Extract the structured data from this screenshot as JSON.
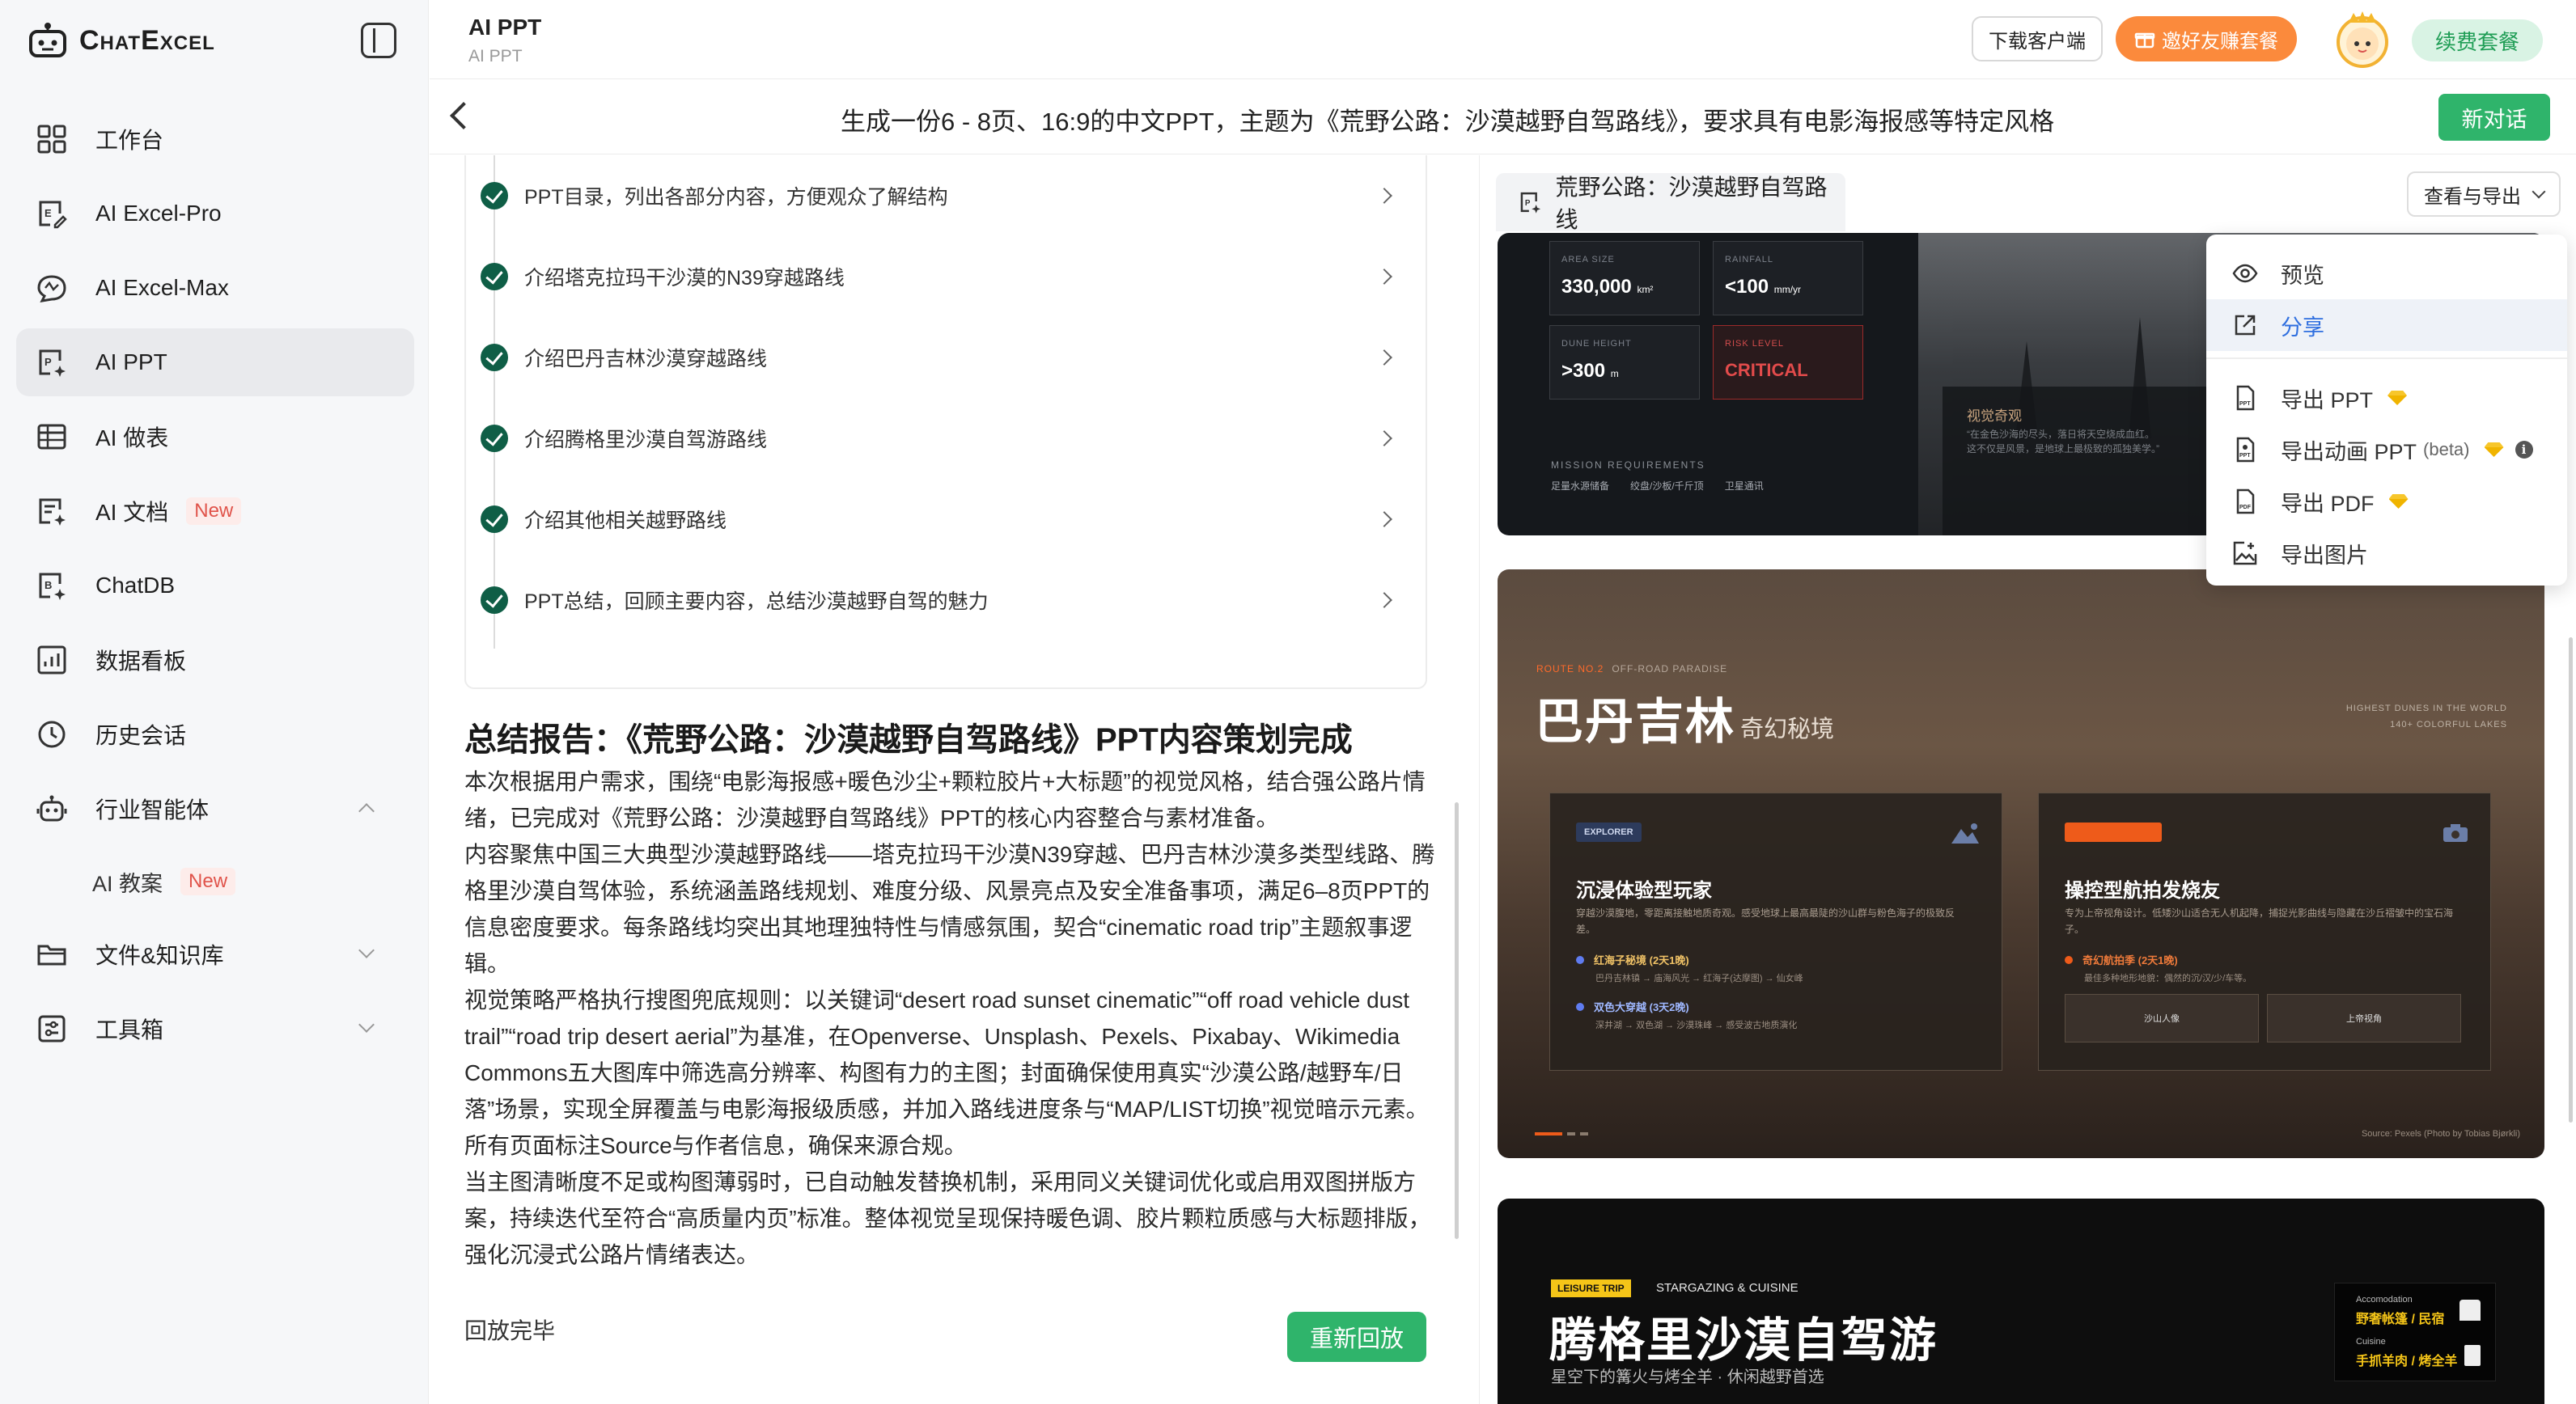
{
  "app": {
    "logo_text": "ChatExcel",
    "title": "AI PPT",
    "subtitle": "AI PPT"
  },
  "sidebar": {
    "items": [
      {
        "label": "工作台",
        "icon": "dashboard-grid-icon"
      },
      {
        "label": "AI Excel-Pro",
        "icon": "excel-edit-icon"
      },
      {
        "label": "AI Excel-Max",
        "icon": "excel-chat-icon"
      },
      {
        "label": "AI PPT",
        "icon": "ppt-icon",
        "active": true
      },
      {
        "label": "AI 做表",
        "icon": "table-icon"
      },
      {
        "label": "AI 文档",
        "icon": "document-icon",
        "badge": "New"
      },
      {
        "label": "ChatDB",
        "icon": "database-icon"
      },
      {
        "label": "数据看板",
        "icon": "chart-board-icon"
      },
      {
        "label": "历史会话",
        "icon": "history-clock-icon"
      },
      {
        "label": "行业智能体",
        "icon": "robot-icon"
      },
      {
        "label": "文件&知识库",
        "icon": "folder-icon"
      },
      {
        "label": "工具箱",
        "icon": "toolbox-icon"
      }
    ],
    "sub_items": [
      {
        "label": "AI 教案",
        "badge": "New"
      }
    ]
  },
  "header": {
    "download_label": "下载客户端",
    "invite_label": "邀好友赚套餐",
    "renew_label": "续费套餐"
  },
  "conversation": {
    "title": "生成一份6 - 8页、16:9的中文PPT，主题为《荒野公路：沙漠越野自驾路线》，要求具有电影海报感等特定风格",
    "new_chat_label": "新对话"
  },
  "steps": [
    "PPT目录，列出各部分内容，方便观众了解结构",
    "介绍塔克拉玛干沙漠的N39穿越路线",
    "介绍巴丹吉林沙漠穿越路线",
    "介绍腾格里沙漠自驾游路线",
    "介绍其他相关越野路线",
    "PPT总结，回顾主要内容，总结沙漠越野自驾的魅力"
  ],
  "report": {
    "title": "总结报告：《荒野公路：沙漠越野自驾路线》PPT内容策划完成",
    "paragraphs": [
      "本次根据用户需求，围绕“电影海报感+暖色沙尘+颗粒胶片+大标题”的视觉风格，结合强公路片情绪，已完成对《荒野公路：沙漠越野自驾路线》PPT的核心内容整合与素材准备。",
      "内容聚焦中国三大典型沙漠越野路线——塔克拉玛干沙漠N39穿越、巴丹吉林沙漠多类型线路、腾格里沙漠自驾体验，系统涵盖路线规划、难度分级、风景亮点及安全准备事项，满足6–8页PPT的信息密度要求。每条路线均突出其地理独特性与情感氛围，契合“cinematic road trip”主题叙事逻辑。",
      "视觉策略严格执行搜图兜底规则：以关键词“desert road sunset cinematic”“off road vehicle dust trail”“road trip desert aerial”为基准，在Openverse、Unsplash、Pexels、Pixabay、Wikimedia Commons五大图库中筛选高分辨率、构图有力的主图；封面确保使用真实“沙漠公路/越野车/日落”场景，实现全屏覆盖与电影海报级质感，并加入路线进度条与“MAP/LIST切换”视觉暗示元素。所有页面标注Source与作者信息，确保来源合规。",
      "当主图清晰度不足或构图薄弱时，已自动触发替换机制，采用同义关键词优化或启用双图拼版方案，持续迭代至符合“高质量内页”标准。整体视觉呈现保持暖色调、胶片颗粒质感与大标题排版，强化沉浸式公路片情绪表达。"
    ],
    "playback_done": "回放完毕",
    "replay_label": "重新回放"
  },
  "preview": {
    "tab_title": "荒野公路：沙漠越野自驾路线",
    "export_label": "查看与导出",
    "slide1": {
      "cards": [
        {
          "label": "AREA SIZE",
          "value": "330,000",
          "unit": "km²"
        },
        {
          "label": "RAINFALL",
          "value": "<100",
          "unit": "mm/yr"
        },
        {
          "label": "DUNE HEIGHT",
          "value": ">300",
          "unit": "m"
        },
        {
          "label": "RISK LEVEL",
          "value": "CRITICAL",
          "unit": ""
        }
      ],
      "mission_label": "MISSION REQUIREMENTS",
      "mission_items": [
        "足量水源储备",
        "绞盘/沙板/千斤顶",
        "卫星通讯"
      ],
      "box_title": "视觉奇观",
      "box_desc": "“在金色沙海的尽头，落日将天空烧成血红。这不仅是风景，是地球上最极致的孤独美学。”"
    },
    "slide2": {
      "tag": "ROUTE NO.2",
      "tag_sub": "OFF-ROAD PARADISE",
      "title": "巴丹吉林",
      "title_sub": "奇幻秘境",
      "right_line1": "HIGHEST DUNES IN THE WORLD",
      "right_line2": "140+ COLORFUL LAKES",
      "card1": {
        "chip": "EXPLORER",
        "head": "沉浸体验型玩家",
        "desc": "穿越沙漠腹地，零距离接触地质奇观。感受地球上最高最陡的沙山群与粉色海子的极致反差。",
        "route1": "红海子秘境 (2天1晚)",
        "route1_d": "巴丹吉林镇 → 庙海风光 → 红海子(达摩图) → 仙女峰",
        "route2": "双色大穿越 (3天2晚)",
        "route2_d": "深井湖 → 双色湖 → 沙漠珠峰 → 感受波古地质演化"
      },
      "card2": {
        "head": "操控型航拍发烧友",
        "desc": "专为上帝视角设计。低矮沙山适合无人机起降，捕捉光影曲线与隐藏在沙丘褶皱中的宝石海子。",
        "route1": "奇幻航拍季 (2天1晚)",
        "route1_d": "最佳多种地形地貌：偶然的沉/汉/少/车等。",
        "btn1": "沙山人像",
        "btn2": "上帝视角"
      },
      "source": "Source: Pexels (Photo by Tobias Bjørkli)"
    },
    "slide3": {
      "tag": "LEISURE TRIP",
      "tag2": "STARGAZING & CUISINE",
      "title": "腾格里沙漠自驾游",
      "subtitle": "星空下的篝火与烤全羊 · 休闲越野首选",
      "box_l1": "Accomodation",
      "box_v1": "野奢帐篷 / 民宿",
      "box_l2": "Cuisine",
      "box_v2": "手抓羊肉 / 烤全羊"
    }
  },
  "export_menu": {
    "items": [
      {
        "label": "预览",
        "icon": "eye-icon"
      },
      {
        "label": "分享",
        "icon": "share-icon",
        "active": true
      },
      {
        "label": "导出 PPT",
        "icon": "ppt-file-icon",
        "premium": true
      },
      {
        "label": "导出动画 PPT",
        "beta": "(beta)",
        "icon": "ppt-anim-file-icon",
        "premium": true,
        "info": true
      },
      {
        "label": "导出 PDF",
        "icon": "pdf-file-icon",
        "premium": true
      },
      {
        "label": "导出图片",
        "icon": "image-file-icon"
      }
    ]
  },
  "colors": {
    "accent_green": "#2fb46b",
    "orange": "#fb8a3c",
    "link_blue": "#2f6fdf"
  }
}
